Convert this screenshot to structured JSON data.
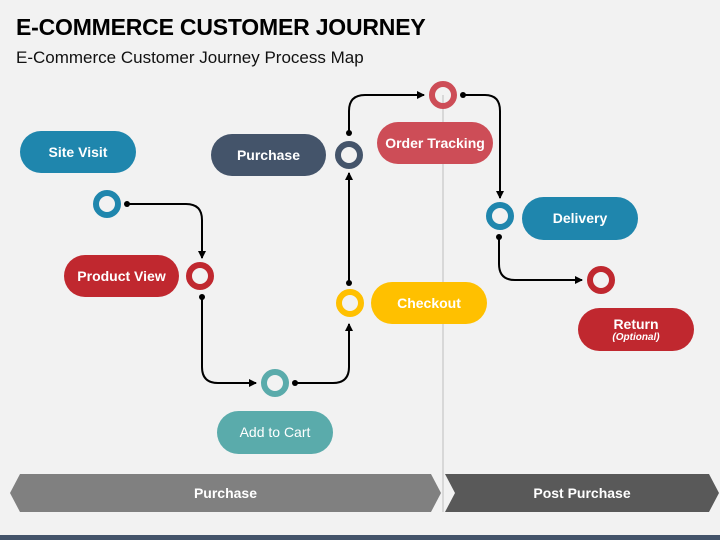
{
  "header": {
    "title": "E-COMMERCE CUSTOMER JOURNEY",
    "subtitle": "E-Commerce Customer Journey Process Map"
  },
  "colors": {
    "blue": "#1f86ad",
    "red": "#c0282f",
    "teal": "#5aabab",
    "yellow": "#ffc000",
    "navy": "#44546a",
    "rose": "#cd4d57",
    "phase_light": "#808080",
    "phase_dark": "#595959"
  },
  "steps": [
    {
      "id": "site-visit",
      "label": "Site Visit",
      "sub": "",
      "color": "#1f86ad"
    },
    {
      "id": "product-view",
      "label": "Product View",
      "sub": "",
      "color": "#c0282f"
    },
    {
      "id": "add-to-cart",
      "label": "Add to Cart",
      "sub": "",
      "color": "#5aabab"
    },
    {
      "id": "checkout",
      "label": "Checkout",
      "sub": "",
      "color": "#ffc000"
    },
    {
      "id": "purchase",
      "label": "Purchase",
      "sub": "",
      "color": "#44546a"
    },
    {
      "id": "order-tracking",
      "label": "Order Tracking",
      "sub": "",
      "color": "#cd4d57"
    },
    {
      "id": "delivery",
      "label": "Delivery",
      "sub": "",
      "color": "#1f86ad"
    },
    {
      "id": "return",
      "label": "Return",
      "sub": "(Optional)",
      "color": "#c0282f"
    }
  ],
  "phases": [
    {
      "label": "Purchase",
      "color": "#808080"
    },
    {
      "label": "Post Purchase",
      "color": "#595959"
    }
  ]
}
